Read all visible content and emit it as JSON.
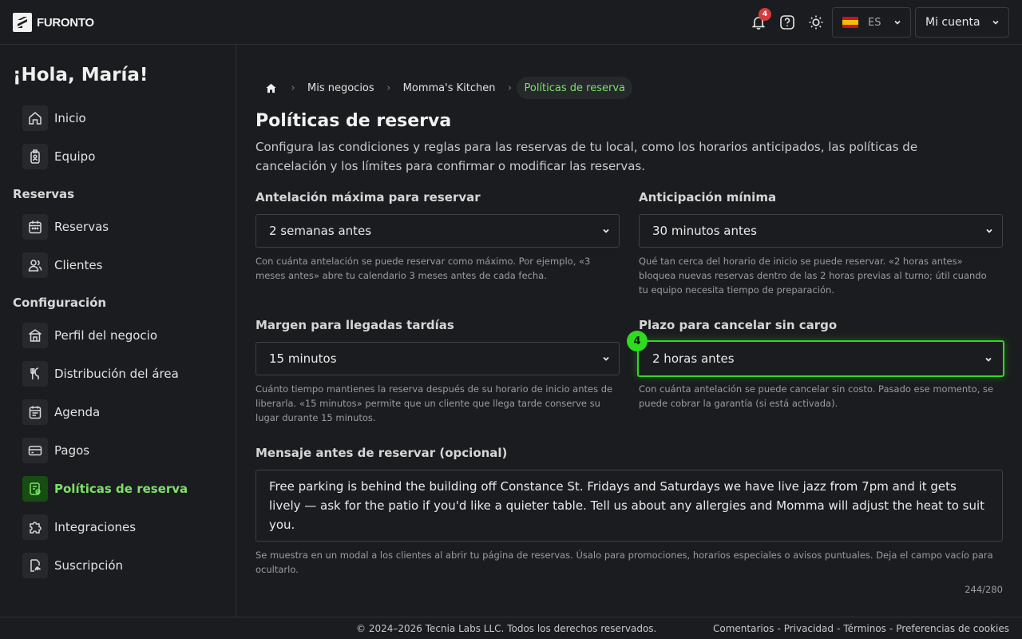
{
  "brand": {
    "name": "FURONTO"
  },
  "header": {
    "notifications_count": "4",
    "language": "ES",
    "account_label": "Mi cuenta"
  },
  "sidebar": {
    "greeting": "¡Hola, María!",
    "items": [
      {
        "label": "Inicio",
        "icon": "home-icon"
      },
      {
        "label": "Equipo",
        "icon": "badge-icon"
      }
    ],
    "sections": [
      {
        "title": "Reservas",
        "items": [
          {
            "label": "Reservas",
            "icon": "calendar-icon"
          },
          {
            "label": "Clientes",
            "icon": "users-icon"
          }
        ]
      },
      {
        "title": "Configuración",
        "items": [
          {
            "label": "Perfil del negocio",
            "icon": "store-icon"
          },
          {
            "label": "Distribución del área",
            "icon": "utensils-icon"
          },
          {
            "label": "Agenda",
            "icon": "agenda-icon"
          },
          {
            "label": "Pagos",
            "icon": "card-icon"
          },
          {
            "label": "Políticas de reserva",
            "icon": "policy-icon",
            "active": true
          },
          {
            "label": "Integraciones",
            "icon": "puzzle-icon"
          },
          {
            "label": "Suscripción",
            "icon": "signature-icon"
          }
        ]
      }
    ]
  },
  "breadcrumb": {
    "items": [
      "Mis negocios",
      "Momma's Kitchen"
    ],
    "current": "Políticas de reserva"
  },
  "page": {
    "title": "Políticas de reserva",
    "description": "Configura las condiciones y reglas para las reservas de tu local, como los horarios anticipados, las políticas de cancelación y los límites para confirmar o modificar las reservas."
  },
  "fields": {
    "max_advance": {
      "label": "Antelación máxima para reservar",
      "value": "2 semanas antes",
      "help": "Con cuánta antelación se puede reservar como máximo. Por ejemplo, «3 meses antes» abre tu calendario 3 meses antes de cada fecha."
    },
    "min_advance": {
      "label": "Anticipación mínima",
      "value": "30 minutos antes",
      "help": "Qué tan cerca del horario de inicio se puede reservar. «2 horas antes» bloquea nuevas reservas dentro de las 2 horas previas al turno; útil cuando tu equipo necesita tiempo de preparación."
    },
    "late_margin": {
      "label": "Margen para llegadas tardías",
      "value": "15 minutos",
      "help": "Cuánto tiempo mantienes la reserva después de su horario de inicio antes de liberarla. «15 minutos» permite que un cliente que llega tarde conserve su lugar durante 15 minutos."
    },
    "free_cancel": {
      "label": "Plazo para cancelar sin cargo",
      "value": "2 horas antes",
      "help": "Con cuánta antelación se puede cancelar sin costo. Pasado ese momento, se puede cobrar la garantía (si está activada).",
      "step_badge": "4"
    },
    "message": {
      "label": "Mensaje antes de reservar (opcional)",
      "value": "Free parking is behind the building off Constance St. Fridays and Saturdays we have live jazz from 7pm and it gets lively — ask for the patio if you'd like a quieter table. Tell us about any allergies and Momma will adjust the heat to suit you.",
      "help": "Se muestra en un modal a los clientes al abrir tu página de reservas. Úsalo para promociones, horarios especiales o avisos puntuales. Deja el campo vacío para ocultarlo.",
      "counter": "244/280"
    }
  },
  "footer": {
    "copyright": "© 2024–2026 Tecnia Labs LLC. Todos los derechos reservados.",
    "links": [
      "Comentarios",
      "Privacidad",
      "Términos",
      "Preferencias de cookies"
    ],
    "separator": "-"
  },
  "colors": {
    "accent": "#7ee06a",
    "focus": "#2ddb1f",
    "background": "#1b1c1f"
  }
}
